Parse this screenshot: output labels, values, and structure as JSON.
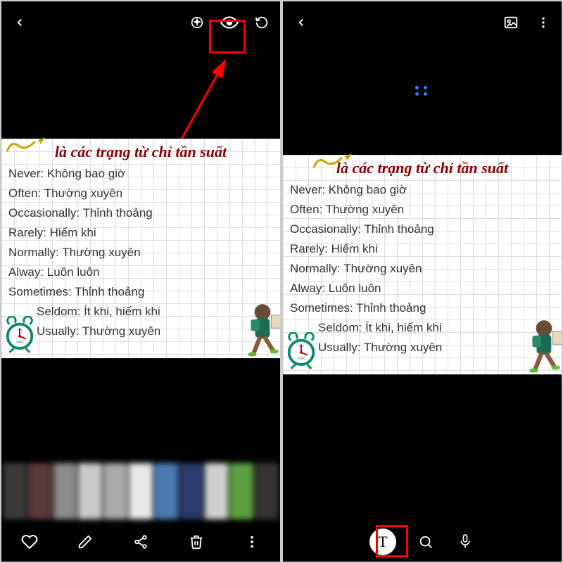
{
  "left": {
    "header": {
      "back_icon": "chevron-left",
      "tools": [
        "sparkle",
        "eye",
        "rotate"
      ]
    },
    "card": {
      "title": "là các trạng từ chỉ tần suất",
      "entries": [
        {
          "en": "Never",
          "vi": "Không bao giờ",
          "indent": false
        },
        {
          "en": "Often",
          "vi": "Thường xuyên",
          "indent": false
        },
        {
          "en": "Occasionally",
          "vi": "Thỉnh thoảng",
          "indent": false
        },
        {
          "en": "Rarely",
          "vi": "Hiếm khi",
          "indent": false
        },
        {
          "en": "Normally",
          "vi": "Thường xuyên",
          "indent": false
        },
        {
          "en": "Alway",
          "vi": "Luôn luôn",
          "indent": false
        },
        {
          "en": "Sometimes",
          "vi": "Thỉnh thoảng",
          "indent": false
        },
        {
          "en": "Seldom",
          "vi": "Ít khi, hiếm khi",
          "indent": true
        },
        {
          "en": "Usually",
          "vi": "Thường xuyên",
          "indent": true
        }
      ]
    },
    "bottombar": {
      "actions": [
        "heart",
        "pencil",
        "share",
        "trash",
        "more"
      ]
    }
  },
  "right": {
    "header": {
      "back_icon": "chevron-left",
      "tools": [
        "image",
        "more"
      ]
    },
    "card": {
      "title": "là các trạng từ chỉ tần suất",
      "entries": [
        {
          "en": "Never",
          "vi": "Không bao giờ",
          "indent": false
        },
        {
          "en": "Often",
          "vi": "Thường xuyên",
          "indent": false
        },
        {
          "en": "Occasionally",
          "vi": "Thỉnh thoảng",
          "indent": false
        },
        {
          "en": "Rarely",
          "vi": "Hiếm khi",
          "indent": false
        },
        {
          "en": "Normally",
          "vi": "Thường xuyên",
          "indent": false
        },
        {
          "en": "Alway",
          "vi": "Luôn luôn",
          "indent": false
        },
        {
          "en": "Sometimes",
          "vi": "Thỉnh thoảng",
          "indent": false
        },
        {
          "en": "Seldom",
          "vi": "Ít khi, hiếm khi",
          "indent": true
        },
        {
          "en": "Usually",
          "vi": "Thường xuyên",
          "indent": true
        }
      ]
    },
    "bottombar": {
      "text_btn": "T",
      "actions": [
        "text",
        "search",
        "mic"
      ]
    }
  },
  "colors": {
    "highlight": "#ff0000",
    "title": "#8b0000",
    "clock": "#0a8a6a"
  }
}
